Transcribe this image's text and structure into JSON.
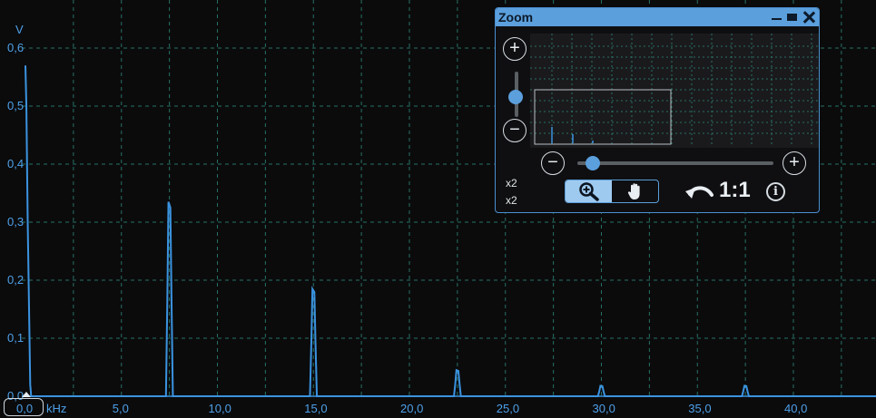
{
  "chart_data": {
    "type": "line",
    "ylabel": "V",
    "xunit": "kHz",
    "xlim": [
      0,
      46
    ],
    "ylim": [
      0,
      0.6
    ],
    "x_ticks": [
      "0,0",
      "5,0",
      "10,0",
      "15,0",
      "20,0",
      "25,0",
      "30,0",
      "35,0",
      "40,0"
    ],
    "y_ticks": [
      "0,0",
      "0,1",
      "0,2",
      "0,3",
      "0,4",
      "0,5",
      "0,6"
    ],
    "peaks": [
      {
        "x": 0.0,
        "y": 0.57
      },
      {
        "x": 7.5,
        "y": 0.335
      },
      {
        "x": 15.0,
        "y": 0.185
      },
      {
        "x": 22.5,
        "y": 0.045
      },
      {
        "x": 30.0,
        "y": 0.018
      },
      {
        "x": 37.5,
        "y": 0.018
      }
    ],
    "grid": true,
    "line_color": "#3b93e0"
  },
  "zoom": {
    "title": "Zoom",
    "x_scale": "x2",
    "y_scale": "x2",
    "ratio_label": "1:1",
    "minimize_icon": "minimize-icon",
    "maximize_icon": "maximize-icon",
    "close_icon": "close-icon",
    "zoom_in_label": "+",
    "zoom_out_label": "−",
    "mode_zoom_icon": "magnifier-plus-icon",
    "mode_pan_icon": "hand-icon",
    "undo_icon": "undo-icon",
    "info_label": "i",
    "h_zoom_level": 0.08,
    "v_zoom_level": 0.6
  },
  "colors": {
    "accent": "#5b9fdc",
    "grid": "#2e8a7a",
    "background": "#0b0b0c"
  }
}
